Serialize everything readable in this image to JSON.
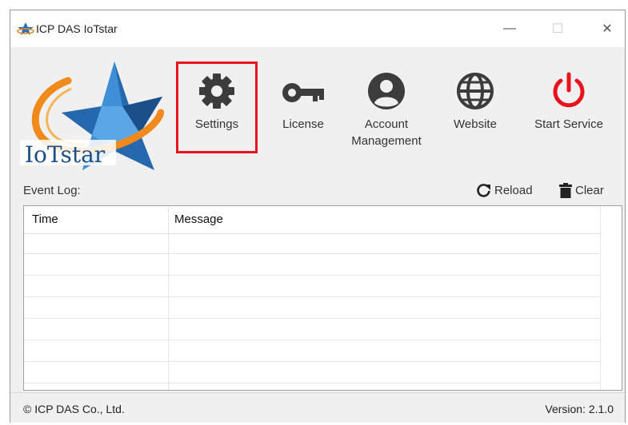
{
  "window": {
    "title": "ICP DAS IoTstar",
    "minimize_glyph": "—",
    "maximize_glyph": "☐",
    "close_glyph": "✕"
  },
  "logo": {
    "text": "IoTstar"
  },
  "toolbar": {
    "settings_label": "Settings",
    "license_label": "License",
    "account_label_1": "Account",
    "account_label_2": "Management",
    "website_label": "Website",
    "start_service_label": "Start Service",
    "start_service_color": "#e8131d",
    "icon_color": "#3c3c3c"
  },
  "event_log": {
    "label": "Event Log:",
    "reload_label": "Reload",
    "clear_label": "Clear",
    "columns": [
      "Time",
      "Message"
    ],
    "rows": []
  },
  "footer": {
    "copyright": "© ICP DAS Co., Ltd.",
    "version": "Version: 2.1.0"
  }
}
